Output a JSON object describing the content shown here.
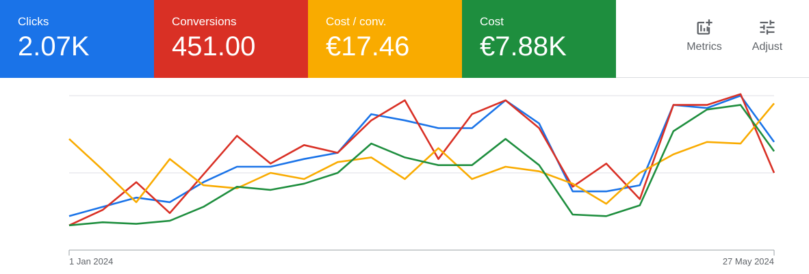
{
  "metrics": [
    {
      "label": "Clicks",
      "value": "2.07K",
      "color": "#1a73e8"
    },
    {
      "label": "Conversions",
      "value": "451.00",
      "color": "#d93025"
    },
    {
      "label": "Cost / conv.",
      "value": "€17.46",
      "color": "#f9ab00"
    },
    {
      "label": "Cost",
      "value": "€7.88K",
      "color": "#1e8e3e"
    }
  ],
  "tools": [
    {
      "label": "Metrics",
      "icon": "add-chart-icon"
    },
    {
      "label": "Adjust",
      "icon": "tune-icon"
    }
  ],
  "chart_data": {
    "type": "line",
    "x_start_label": "1 Jan 2024",
    "x_end_label": "27 May 2024",
    "grid": true,
    "ylim": [
      0,
      100
    ],
    "series": [
      {
        "key": "clicks",
        "color": "#1a73e8",
        "values": [
          22,
          28,
          34,
          31,
          44,
          54,
          54,
          59,
          63,
          88,
          84,
          79,
          79,
          97,
          82,
          38,
          38,
          42,
          94,
          92,
          100,
          70
        ]
      },
      {
        "key": "conversions",
        "color": "#d93025",
        "values": [
          16,
          26,
          44,
          24,
          49,
          74,
          56,
          68,
          63,
          84,
          97,
          59,
          88,
          97,
          79,
          41,
          56,
          33,
          94,
          94,
          101,
          50
        ]
      },
      {
        "key": "cost_per_conv",
        "color": "#f9ab00",
        "values": [
          72,
          52,
          31,
          59,
          42,
          40,
          50,
          46,
          57,
          60,
          46,
          66,
          46,
          54,
          51,
          43,
          30,
          50,
          62,
          70,
          69,
          95
        ]
      },
      {
        "key": "cost",
        "color": "#1e8e3e",
        "values": [
          16,
          18,
          17,
          19,
          28,
          41,
          39,
          43,
          50,
          69,
          60,
          55,
          55,
          72,
          55,
          23,
          22,
          29,
          77,
          91,
          94,
          64
        ]
      }
    ]
  }
}
